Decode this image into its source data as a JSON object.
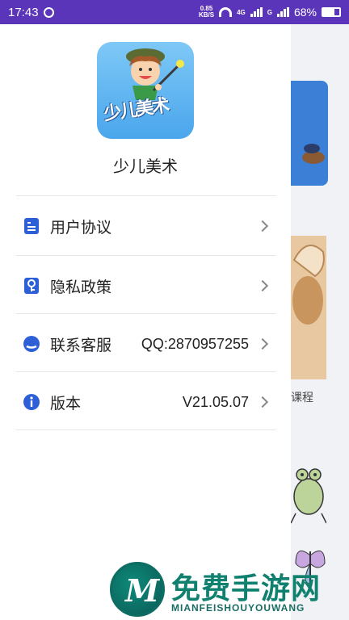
{
  "status_bar": {
    "time": "17:43",
    "net_speed_value": "0.85",
    "net_speed_unit": "KB/S",
    "signal_1_label": "4G",
    "signal_2_label": "G",
    "battery": "68%",
    "battery_level": 0.68,
    "color": "#5a35b9"
  },
  "drawer": {
    "app_name": "少儿美术",
    "logo_text": "少儿美术",
    "menu": [
      {
        "label": "用户协议",
        "value": "",
        "icon": "document-icon",
        "icon_color": "#2d5fd6"
      },
      {
        "label": "隐私政策",
        "value": "",
        "icon": "key-icon",
        "icon_color": "#2d5fd6"
      },
      {
        "label": "联系客服",
        "value": "QQ:2870957255",
        "icon": "service-icon",
        "icon_color": "#2d5fd6"
      },
      {
        "label": "版本",
        "value": "V21.05.07",
        "icon": "info-icon",
        "icon_color": "#2d5fd6"
      }
    ]
  },
  "background": {
    "partial_label": "课程"
  },
  "watermark": {
    "title": "免费手游网",
    "subtitle": "MIANFEISHOUYOUWANG",
    "letter": "M"
  }
}
